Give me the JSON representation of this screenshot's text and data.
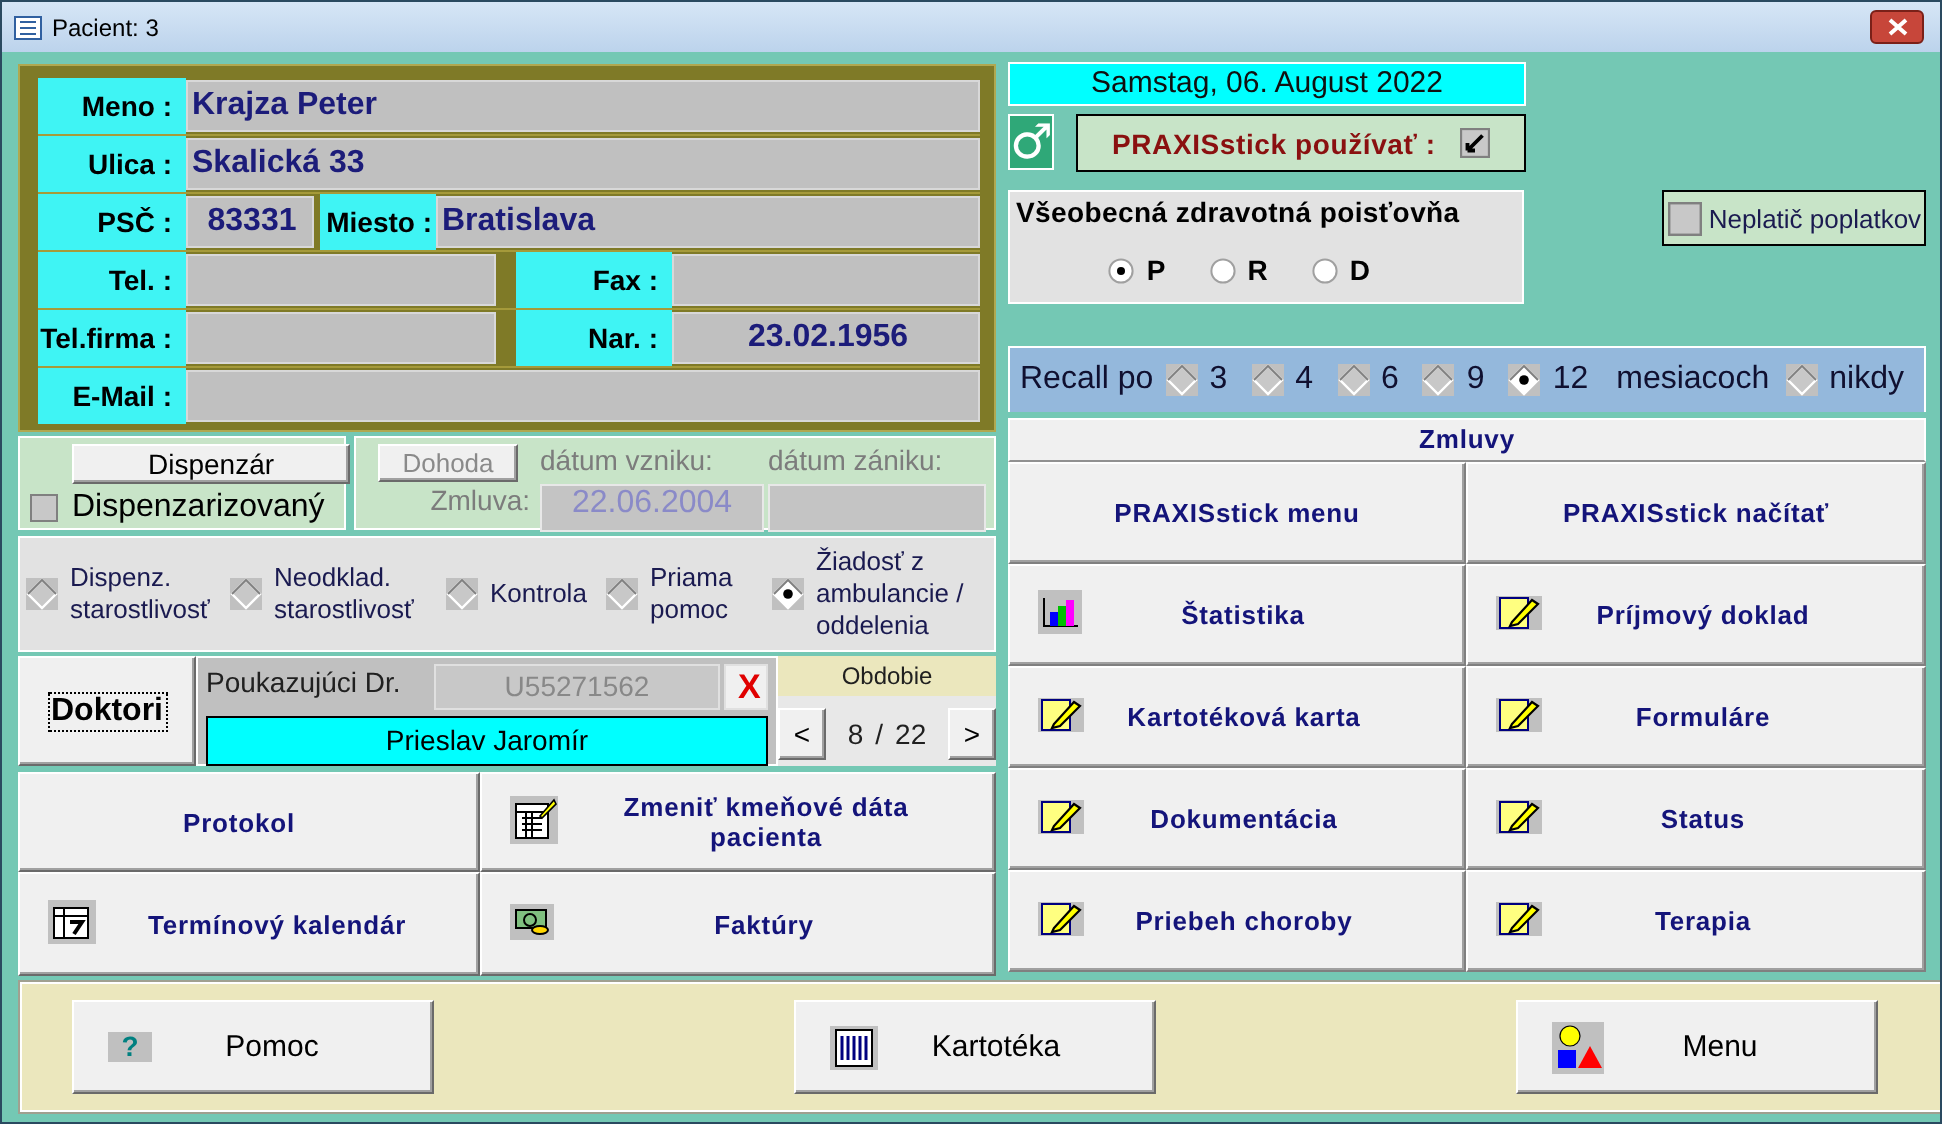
{
  "window": {
    "title": "Pacient: 3"
  },
  "patient": {
    "rows": [
      {
        "kind": "single",
        "fields": [
          {
            "label": "Meno :",
            "value": "Krajza Peter"
          }
        ]
      },
      {
        "kind": "single",
        "fields": [
          {
            "label": "Ulica :",
            "value": "Skalická 33"
          }
        ]
      },
      {
        "kind": "address",
        "fields": [
          {
            "label": "PSČ :",
            "value": "83331"
          },
          {
            "label": "Miesto :",
            "value": "Bratislava"
          }
        ]
      },
      {
        "kind": "pair",
        "fields": [
          {
            "label": "Tel. :"
          },
          {
            "label": "Fax :"
          }
        ]
      },
      {
        "kind": "pair",
        "fields": [
          {
            "label": "Tel.firma :"
          },
          {
            "label": "Nar. :",
            "value": "23.02.1956"
          }
        ]
      },
      {
        "kind": "single",
        "fields": [
          {
            "label": "E-Mail :"
          }
        ]
      }
    ]
  },
  "dispenzar": {
    "button": "Dispenzár",
    "checkbox": {
      "label": "Dispenzarizovaný",
      "checked": false
    }
  },
  "contract": {
    "button": "Dohoda",
    "disabled": true,
    "created_label": "dátum vzniku:",
    "ended_label": "dátum zániku:",
    "contract_label": "Zmluva:",
    "created_value": "22.06.2004"
  },
  "care_types": [
    {
      "label": "Dispenz.\nstarostlivosť",
      "selected": false
    },
    {
      "label": "Neodklad.\nstarostlivosť",
      "selected": false
    },
    {
      "label": "Kontrola",
      "selected": false
    },
    {
      "label": "Priama\npomoc",
      "selected": false
    },
    {
      "label": "Žiadosť z\nambulancie /\noddelenia",
      "selected": true
    }
  ],
  "doctors": {
    "button": "Doktori",
    "referring_label": "Poukazujúci Dr.",
    "code": "U55271562",
    "clear": "X",
    "name": "Prieslav Jaromír"
  },
  "period": {
    "label": "Obdobie",
    "prev": "<",
    "current": "8",
    "separator": "/",
    "total": "22",
    "next": ">"
  },
  "left_buttons": [
    {
      "label": "Protokol"
    },
    {
      "label": "Zmeniť kmeňové dáta pacienta"
    },
    {
      "label": "Termínový kalendár"
    },
    {
      "label": "Faktúry"
    }
  ],
  "date": "Samstag, 06. August 2022",
  "gender_symbol": "♂",
  "praxisstick": {
    "label": "PRAXISstick používať :",
    "checked": true
  },
  "insurance": {
    "name": "Všeobecná zdravotná poisťovňa",
    "options": [
      {
        "label": "P",
        "selected": true
      },
      {
        "label": "R",
        "selected": false
      },
      {
        "label": "D",
        "selected": false
      }
    ]
  },
  "non_payer": {
    "label": "Neplatič poplatkov",
    "checked": false
  },
  "recall": {
    "label": "Recall po",
    "options": [
      {
        "label": "3",
        "selected": false
      },
      {
        "label": "4",
        "selected": false
      },
      {
        "label": "6",
        "selected": false
      },
      {
        "label": "9",
        "selected": false
      },
      {
        "label": "12",
        "selected": true
      }
    ],
    "unit": "mesiacoch",
    "never": {
      "label": "nikdy",
      "selected": false
    }
  },
  "contracts_header": "Zmluvy",
  "menu_buttons": [
    {
      "label": "PRAXISstick menu"
    },
    {
      "label": "PRAXISstick načítať"
    },
    {
      "label": "Štatistika"
    },
    {
      "label": "Príjmový doklad"
    },
    {
      "label": "Kartotéková karta"
    },
    {
      "label": "Formuláre"
    },
    {
      "label": "Dokumentácia"
    },
    {
      "label": "Status"
    },
    {
      "label": "Priebeh choroby"
    },
    {
      "label": "Terapia"
    }
  ],
  "bottom_buttons": [
    {
      "label": "Pomoc",
      "glyph": "?"
    },
    {
      "label": "Kartotéka"
    },
    {
      "label": "Menu"
    }
  ]
}
